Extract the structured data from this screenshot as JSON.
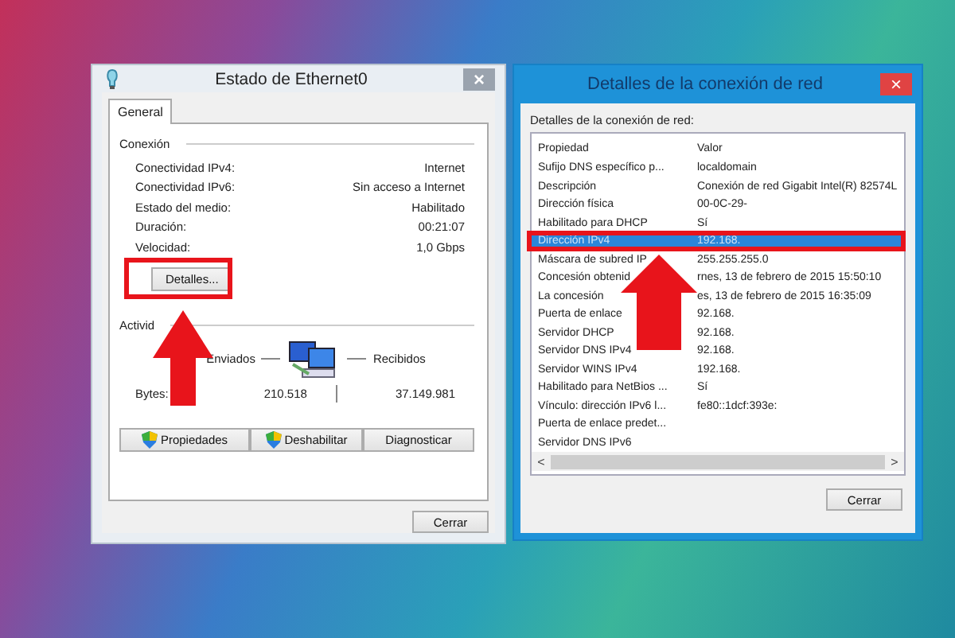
{
  "status_window": {
    "title": "Estado de Ethernet0",
    "close_glyph": "×",
    "tabs": [
      {
        "label": "General",
        "selected": true
      }
    ],
    "connection": {
      "heading": "Conexión",
      "rows": [
        {
          "label": "Conectividad IPv4:",
          "value": "Internet"
        },
        {
          "label": "Conectividad IPv6:",
          "value": "Sin acceso a Internet"
        },
        {
          "label": "Estado del medio:",
          "value": "Habilitado"
        },
        {
          "label": "Duración:",
          "value": "00:21:07"
        },
        {
          "label": "Velocidad:",
          "value": "1,0 Gbps"
        }
      ]
    },
    "details_button": "Detalles...",
    "activity": {
      "heading": "Activid",
      "sent_label": "Enviados",
      "received_label": "Recibidos",
      "bytes_label": "Bytes:",
      "bytes_sent": "210.518",
      "bytes_received": "37.149.981"
    },
    "buttons": [
      {
        "label": "Propiedades",
        "kind": "shield"
      },
      {
        "label": "Deshabilitar",
        "kind": "shield"
      },
      {
        "label": "Diagnosticar",
        "kind": "plain"
      }
    ],
    "close_button": "Cerrar"
  },
  "details_window": {
    "title": "Detalles de la conexión de red",
    "close_glyph": "×",
    "list_label": "Detalles de la conexión de red:",
    "columns": [
      "Propiedad",
      "Valor"
    ],
    "rows": [
      {
        "property": "Sufijo DNS específico p...",
        "value": "localdomain",
        "selected": false
      },
      {
        "property": "Descripción",
        "value": "Conexión de red Gigabit Intel(R) 82574L",
        "selected": false
      },
      {
        "property": "Dirección física",
        "value": "00-0C-29-",
        "selected": false
      },
      {
        "property": "Habilitado para DHCP",
        "value": "Sí",
        "selected": false
      },
      {
        "property": "Dirección IPv4",
        "value": "192.168.",
        "selected": true
      },
      {
        "property": "Máscara de subred IP",
        "value": "255.255.255.0",
        "selected": false
      },
      {
        "property": "Concesión obtenid",
        "value": "rnes, 13 de febrero de 2015 15:50:10",
        "selected": false
      },
      {
        "property": "La concesión",
        "value": "es, 13 de febrero de 2015 16:35:09",
        "selected": false
      },
      {
        "property": "Puerta de enlace",
        "value": "92.168.",
        "selected": false
      },
      {
        "property": "Servidor DHCP",
        "value": "92.168.",
        "selected": false
      },
      {
        "property": "Servidor DNS IPv4",
        "value": "92.168.",
        "selected": false
      },
      {
        "property": "Servidor WINS IPv4",
        "value": "192.168.",
        "selected": false
      },
      {
        "property": "Habilitado para NetBios ...",
        "value": "Sí",
        "selected": false
      },
      {
        "property": "Vínculo: dirección IPv6 l...",
        "value": "fe80::1dcf:393e:",
        "selected": false
      },
      {
        "property": "Puerta de enlace predet...",
        "selected": false
      },
      {
        "property": "Servidor DNS IPv6",
        "selected": false
      }
    ],
    "scroll_left": "<",
    "scroll_right": ">",
    "close_button": "Cerrar"
  }
}
